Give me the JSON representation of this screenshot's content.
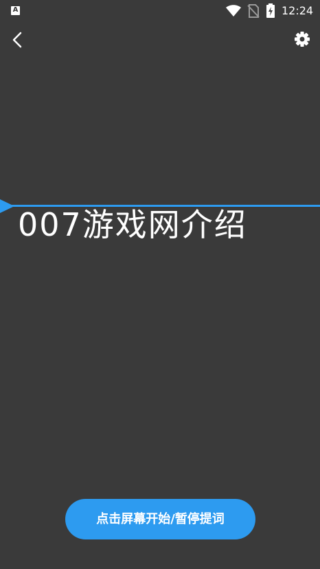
{
  "status_bar": {
    "app_icon_letter": "A",
    "time": "12:24",
    "icons": [
      "wifi-icon",
      "no-sim-icon",
      "battery-charging-icon"
    ]
  },
  "toolbar": {
    "back_icon": "chevron-left-icon",
    "settings_icon": "gear-icon"
  },
  "prompter": {
    "text": "007游戏网介绍"
  },
  "controls": {
    "play_pause_label": "点击屏幕开始/暂停提词"
  },
  "colors": {
    "background": "#3a3a3a",
    "accent": "#2d9bf0",
    "text": "#ffffff"
  }
}
